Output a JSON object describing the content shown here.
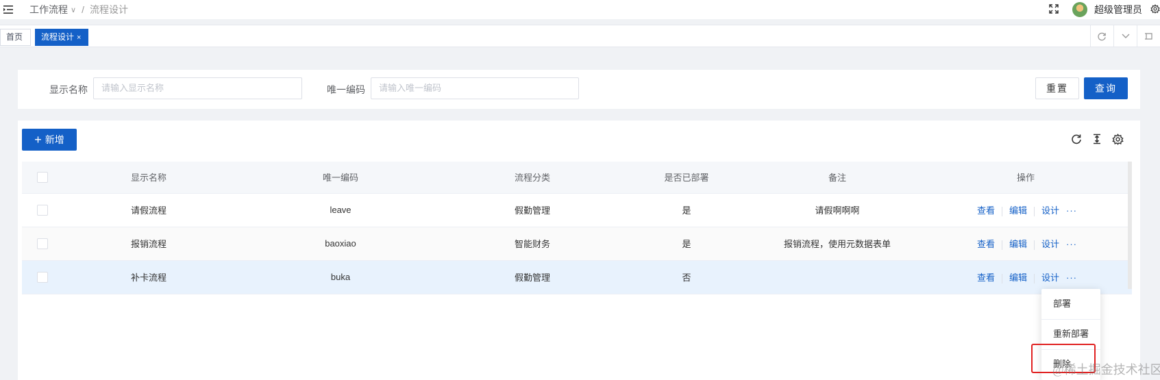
{
  "header": {
    "breadcrumb": [
      "工作流程",
      "流程设计"
    ],
    "breadcrumb_sep": "/",
    "username": "超级管理员"
  },
  "tabs": [
    {
      "label": "首页",
      "active": false
    },
    {
      "label": "流程设计",
      "active": true,
      "close": "×"
    }
  ],
  "search": {
    "name_label": "显示名称",
    "name_placeholder": "请输入显示名称",
    "code_label": "唯一编码",
    "code_placeholder": "请输入唯一编码",
    "reset_label": "重置",
    "query_label": "查询"
  },
  "toolbar": {
    "add_label": "新增"
  },
  "table": {
    "columns": [
      "显示名称",
      "唯一编码",
      "流程分类",
      "是否已部署",
      "备注",
      "操作"
    ],
    "rows": [
      {
        "name": "请假流程",
        "code": "leave",
        "category": "假勤管理",
        "deployed": "是",
        "remark": "请假啊啊啊"
      },
      {
        "name": "报销流程",
        "code": "baoxiao",
        "category": "智能财务",
        "deployed": "是",
        "remark": "报销流程，使用元数据表单"
      },
      {
        "name": "补卡流程",
        "code": "buka",
        "category": "假勤管理",
        "deployed": "否",
        "remark": ""
      }
    ],
    "actions": {
      "view": "查看",
      "edit": "编辑",
      "design": "设计",
      "more": "···"
    }
  },
  "dropdown": {
    "items": [
      "部署",
      "重新部署",
      "删除"
    ]
  },
  "watermark": "@稀土掘金技术社区",
  "colors": {
    "primary": "#1460c7",
    "highlight": "#e02020"
  }
}
